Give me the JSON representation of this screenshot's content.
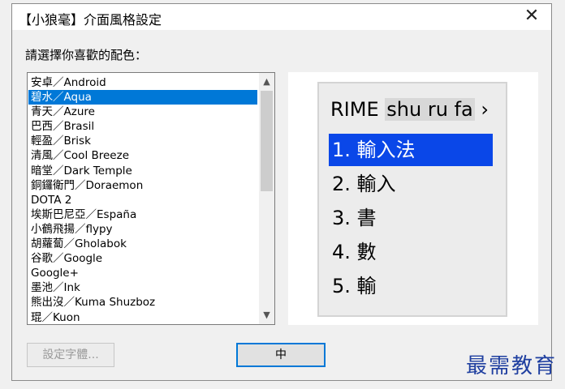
{
  "window": {
    "title": "【小狼毫】介面風格設定",
    "close_glyph": "✕"
  },
  "prompt": "請選擇你喜歡的配色：",
  "schemes": [
    {
      "label": "安卓／Android",
      "selected": false
    },
    {
      "label": "碧水／Aqua",
      "selected": true
    },
    {
      "label": "青天／Azure",
      "selected": false
    },
    {
      "label": "巴西／Brasil",
      "selected": false
    },
    {
      "label": "輕盈／Brisk",
      "selected": false
    },
    {
      "label": "清風／Cool Breeze",
      "selected": false
    },
    {
      "label": "暗堂／Dark Temple",
      "selected": false
    },
    {
      "label": "銅鑼衛門／Doraemon",
      "selected": false
    },
    {
      "label": "DOTA 2",
      "selected": false
    },
    {
      "label": "埃斯巴尼亞／España",
      "selected": false
    },
    {
      "label": "小鶴飛揚／flypy",
      "selected": false
    },
    {
      "label": "胡蘿蔔／Gholabok",
      "selected": false
    },
    {
      "label": "谷歌／Google",
      "selected": false
    },
    {
      "label": "Google+",
      "selected": false
    },
    {
      "label": "墨池／Ink",
      "selected": false
    },
    {
      "label": "熊出沒／Kuma Shuzboz",
      "selected": false
    },
    {
      "label": "琨／Kuon",
      "selected": false
    }
  ],
  "scrollbar": {
    "up": "▲",
    "down": "▼"
  },
  "preview": {
    "brand": "RIME",
    "code": "shu ru fa",
    "arrow": "›",
    "candidates": [
      {
        "text": "1. 輸入法",
        "highlighted": true
      },
      {
        "text": "2. 輸入",
        "highlighted": false
      },
      {
        "text": "3. 書",
        "highlighted": false
      },
      {
        "text": "4. 數",
        "highlighted": false
      },
      {
        "text": "5. 輸",
        "highlighted": false
      }
    ]
  },
  "buttons": {
    "font_settings": "設定字體...",
    "ok": "中"
  },
  "watermark": "最需教育",
  "colors": {
    "selection": "#0078d7",
    "candidate_highlight": "#0a47e8"
  }
}
